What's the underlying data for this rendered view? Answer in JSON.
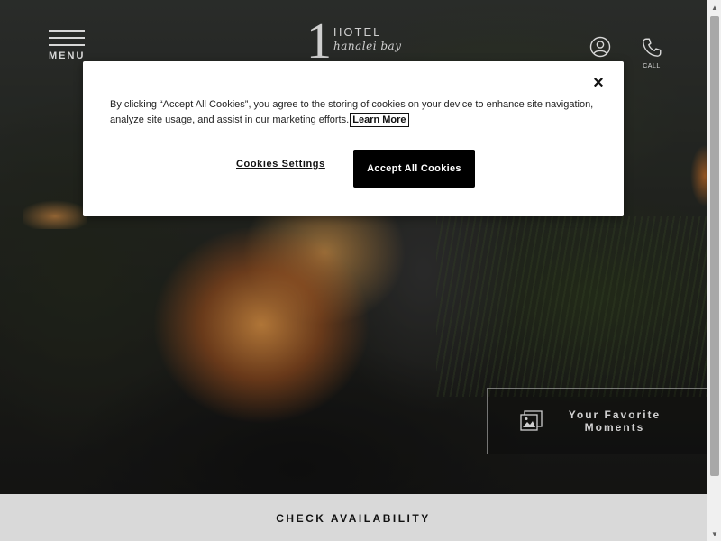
{
  "header": {
    "menu_label": "MENU",
    "logo_number": "1",
    "logo_hotel": "HOTEL",
    "logo_script": "hanalei bay",
    "call_label": "CALL"
  },
  "cookie_banner": {
    "text": "By clicking “Accept All Cookies”, you agree to the storing of cookies on your device to enhance site navigation, analyze site usage, and assist in our marketing efforts.",
    "learn_more": "Learn More",
    "settings_label": "Cookies Settings",
    "accept_label": "Accept All Cookies",
    "close_glyph": "×"
  },
  "moments": {
    "label": "Your Favorite Moments"
  },
  "check_availability": {
    "label": "CHECK AVAILABILITY"
  },
  "colors": {
    "dialog_bg": "#ffffff",
    "accept_bg": "#000000",
    "bar_bg": "#d9d9d9",
    "header_fg": "#d8d8d8"
  },
  "icons": {
    "account": "user-circle-icon",
    "call": "phone-icon",
    "moments": "image-gallery-icon",
    "close": "close-icon"
  }
}
